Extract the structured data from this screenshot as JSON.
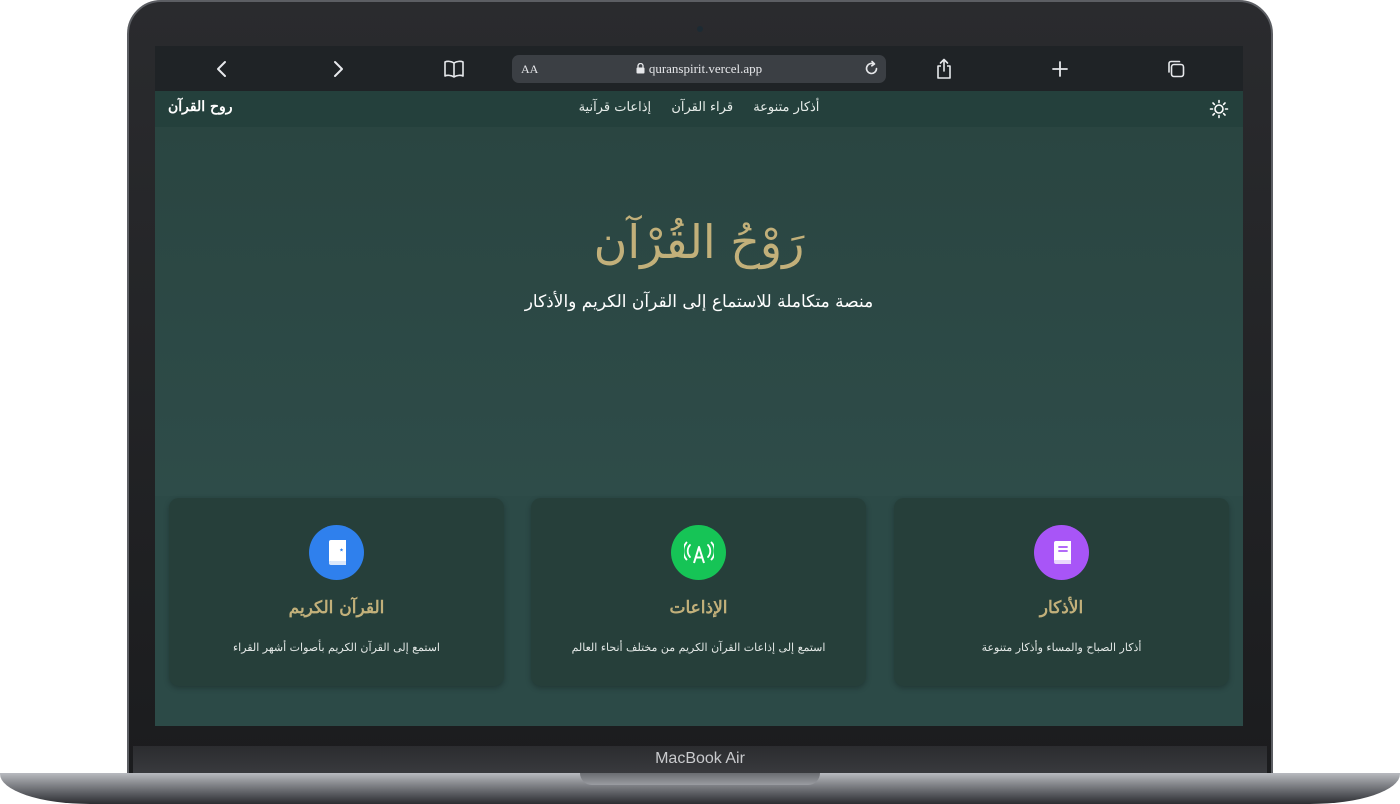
{
  "device": {
    "label": "MacBook Air"
  },
  "browser": {
    "text_size_label": "AA",
    "url": "quranspirit.vercel.app",
    "icons": [
      "back-icon",
      "forward-icon",
      "bookmarks-icon",
      "lock-icon",
      "reload-icon",
      "share-icon",
      "new-tab-icon",
      "tabs-icon"
    ]
  },
  "nav": {
    "brand": "روح القرآن",
    "links": [
      "أذكار متنوعة",
      "قراء القرآن",
      "إذاعات قرآنية"
    ],
    "theme_icon": "sun-icon"
  },
  "hero": {
    "title": "رَوْحُ القُرْآن",
    "subtitle": "منصة متكاملة للاستماع إلى القرآن الكريم والأذكار"
  },
  "cards": [
    {
      "title": "القرآن الكريم",
      "description": "استمع إلى القرآن الكريم بأصوات أشهر القراء",
      "icon": "quran-book-icon",
      "color": "#2f80ed"
    },
    {
      "title": "الإذاعات",
      "description": "استمع إلى إذاعات القرآن الكريم من مختلف أنحاء العالم",
      "icon": "radio-broadcast-icon",
      "color": "#16c456"
    },
    {
      "title": "الأذكار",
      "description": "أذكار الصباح والمساء وأذكار متنوعة",
      "icon": "book-icon",
      "color": "#a855f7"
    }
  ]
}
